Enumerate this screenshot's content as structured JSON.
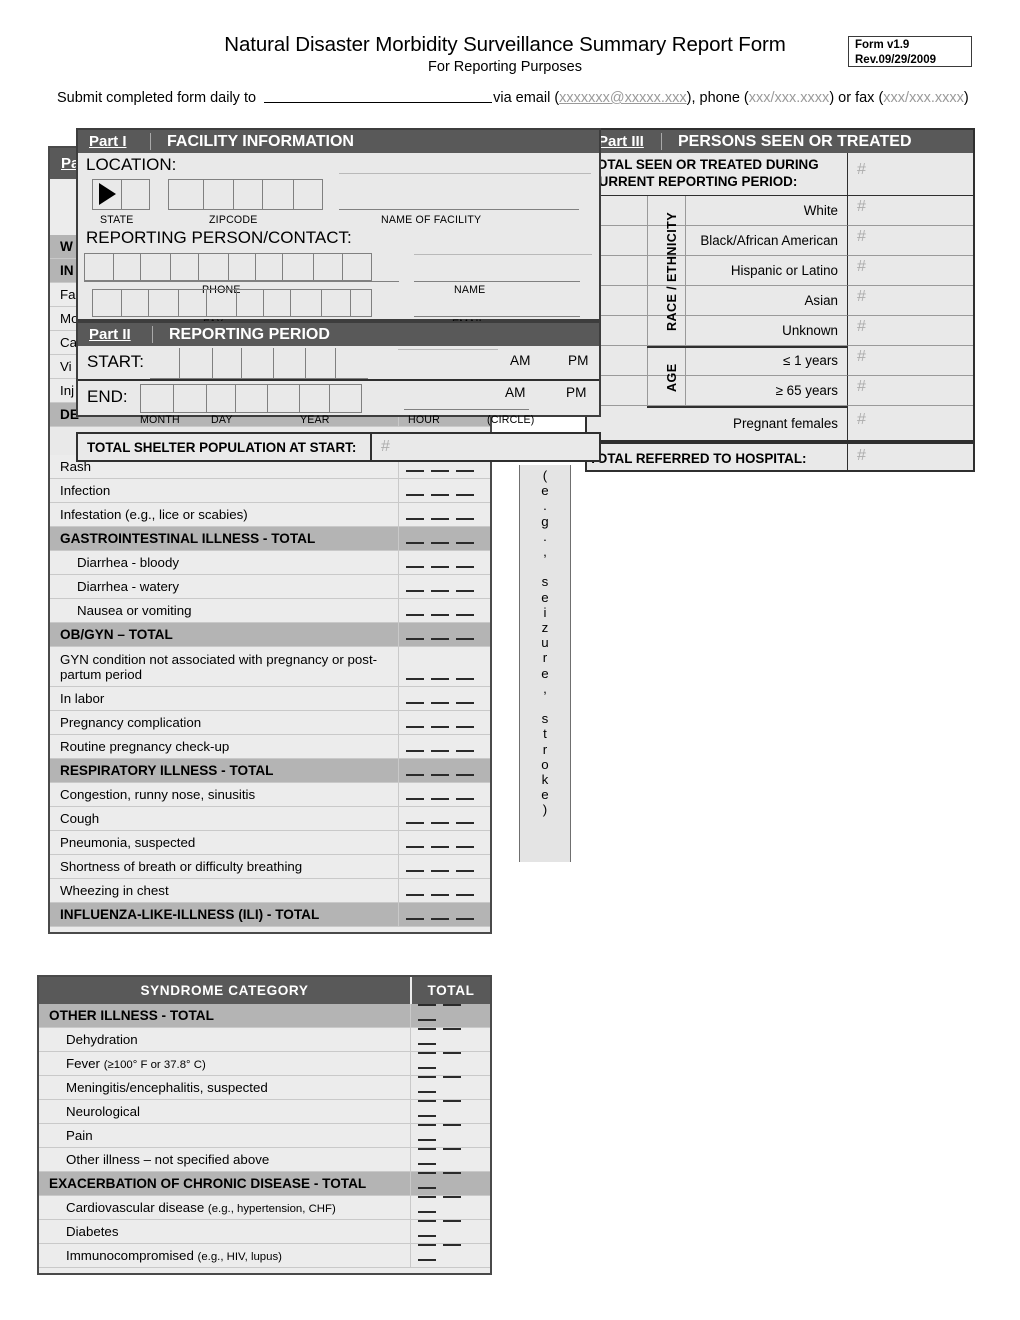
{
  "header": {
    "title": "Natural Disaster Morbidity Surveillance Summary Report Form",
    "subtitle": "For Reporting Purposes",
    "version": "Form v1.9",
    "revision": "Rev.09/29/2009",
    "submit_prefix": "Submit completed form daily to ",
    "submit_mid": "via email (",
    "email_placeholder": "xxxxxxx@xxxxx.xxx",
    "submit_phone_prefix": "), phone (",
    "phone_placeholder": "xxx/xxx.xxxx",
    "submit_fax_prefix": ") or fax (",
    "fax_placeholder": "xxx/xxx.xxxx",
    "submit_suffix": ")"
  },
  "part1": {
    "part_label": "Part I",
    "title": "FACILITY INFORMATION",
    "location_label": "LOCATION:",
    "contact_label": "REPORTING PERSON/CONTACT:",
    "cap_state": "STATE",
    "cap_zipcode": "ZIPCODE",
    "cap_facility": "NAME OF FACILITY",
    "cap_phone": "PHONE",
    "cap_name": "NAME",
    "cap_fax": "FAX",
    "cap_email": "EMAIL"
  },
  "part2": {
    "part_label": "Part II",
    "title": "REPORTING PERIOD",
    "start_label": "START:",
    "end_label": "END:",
    "am": "AM",
    "pm": "PM",
    "am2": "AM",
    "pm2": "PM",
    "cap_month": "MONTH",
    "cap_day": "DAY",
    "cap_year": "YEAR",
    "cap_hour": "HOUR",
    "cap_circle": "(CIRCLE)"
  },
  "shelter": {
    "label": "TOTAL SHELTER POPULATION AT START:",
    "value": "#"
  },
  "part3": {
    "part_label": "Part III",
    "title": "PERSONS SEEN OR TREATED",
    "total_label": "TOTAL SEEN OR TREATED DURING CURRENT REPORTING PERIOD:",
    "total_value": "#",
    "race_group_label": "RACE / ETHNICITY",
    "age_group_label": "AGE",
    "rows": [
      {
        "label": "White",
        "value": "#"
      },
      {
        "label": "Black/African American",
        "value": "#"
      },
      {
        "label": "Hispanic or Latino",
        "value": "#"
      },
      {
        "label": "Asian",
        "value": "#"
      },
      {
        "label": "Unknown",
        "value": "#"
      },
      {
        "label": "≤ 1 years",
        "value": "#"
      },
      {
        "label": "≥ 65 years",
        "value": "#"
      },
      {
        "label": "Pregnant females",
        "value": "#"
      }
    ],
    "hospital_label": "TOTAL REFERRED TO HOSPITAL:",
    "hospital_value": "#"
  },
  "part4_hidden": {
    "part_label": "Part IV",
    "occluded_rows": [
      "W",
      "IN",
      "Fa",
      "Mo",
      "Ca",
      "Vi",
      "Inj",
      "DE"
    ]
  },
  "syndrome_table_1": {
    "rows": [
      {
        "label": "Rash",
        "style": "item",
        "total": "blanks"
      },
      {
        "label": "Infection",
        "style": "item",
        "total": "blanks"
      },
      {
        "label": "Infestation (e.g., lice or scabies)",
        "style": "item",
        "total": "blanks"
      },
      {
        "label": "GASTROINTESTINAL ILLNESS - TOTAL",
        "style": "group",
        "total": "blanks"
      },
      {
        "label": "Diarrhea - bloody",
        "style": "indent",
        "total": "blanks"
      },
      {
        "label": "Diarrhea - watery",
        "style": "indent",
        "total": "blanks"
      },
      {
        "label": "Nausea or vomiting",
        "style": "indent",
        "total": "blanks"
      },
      {
        "label": "OB/GYN – TOTAL",
        "style": "group",
        "total": "blanks"
      },
      {
        "label": "GYN condition not associated with pregnancy or post-partum period",
        "style": "item-tall",
        "total": "blanks"
      },
      {
        "label": "In labor",
        "style": "item",
        "total": "blanks"
      },
      {
        "label": "Pregnancy complication",
        "style": "item",
        "total": "blanks"
      },
      {
        "label": "Routine pregnancy check-up",
        "style": "item",
        "total": "blanks"
      },
      {
        "label": "RESPIRATORY ILLNESS - TOTAL",
        "style": "group",
        "total": "blanks"
      },
      {
        "label": "Congestion, runny nose, sinusitis",
        "style": "item",
        "total": "blanks"
      },
      {
        "label": "Cough",
        "style": "item",
        "total": "blanks"
      },
      {
        "label": "Pneumonia, suspected",
        "style": "item",
        "total": "blanks"
      },
      {
        "label": "Shortness of breath or difficulty breathing",
        "style": "item",
        "total": "blanks"
      },
      {
        "label": "Wheezing in chest",
        "style": "item",
        "total": "blanks"
      },
      {
        "label": "INFLUENZA-LIKE-ILLNESS (ILI) - TOTAL",
        "style": "group",
        "total": "blanks"
      }
    ]
  },
  "overflow_vertical_text": "(e.g., seizure, stroke)",
  "syndrome_table_2": {
    "header_category": "SYNDROME CATEGORY",
    "header_total": "TOTAL",
    "rows": [
      {
        "label": "OTHER ILLNESS - TOTAL",
        "style": "group",
        "total": "blanks"
      },
      {
        "label": "Dehydration",
        "style": "indent",
        "total": "blanks"
      },
      {
        "label": "Fever",
        "note": "(≥100° F or 37.8° C)",
        "style": "indent-note",
        "total": "blanks"
      },
      {
        "label": "Meningitis/encephalitis, suspected",
        "style": "indent",
        "total": "blanks"
      },
      {
        "label": "Neurological",
        "style": "indent",
        "total": "blanks"
      },
      {
        "label": "Pain",
        "style": "indent",
        "total": "blanks"
      },
      {
        "label": "Other illness – not specified above",
        "style": "indent",
        "total": "blanks"
      },
      {
        "label": "EXACERBATION OF CHRONIC DISEASE - TOTAL",
        "style": "group",
        "total": "blanks"
      },
      {
        "label": "Cardiovascular disease",
        "note": "(e.g., hypertension, CHF)",
        "style": "indent-note",
        "total": "blanks"
      },
      {
        "label": "Diabetes",
        "style": "indent",
        "total": "blanks"
      },
      {
        "label": "Immunocompromised",
        "note": "(e.g., HIV, lupus)",
        "style": "indent-note",
        "total": "blanks"
      }
    ]
  }
}
